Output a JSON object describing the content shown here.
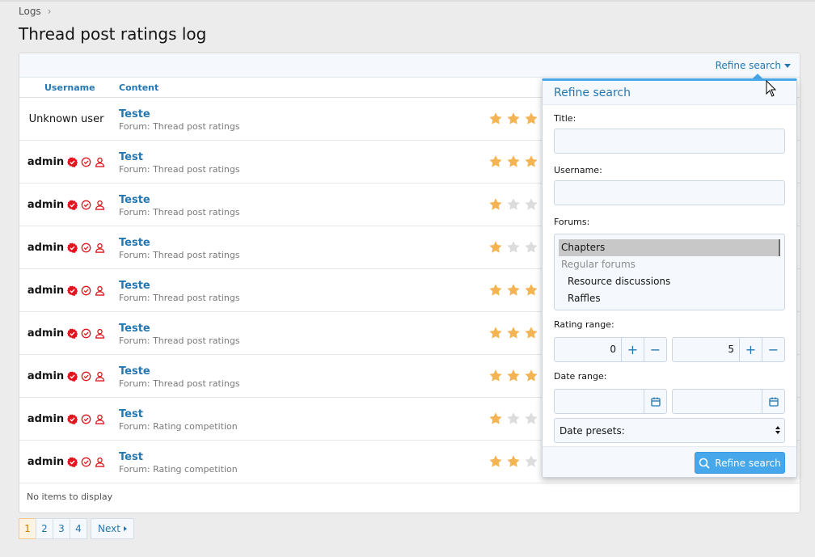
{
  "breadcrumb": {
    "item": "Logs"
  },
  "page_title": "Thread post ratings log",
  "filter_bar": {
    "refine_link": "Refine search"
  },
  "table": {
    "columns": [
      "Username",
      "Content"
    ],
    "rows": [
      {
        "user": "Unknown user",
        "unknown": true,
        "title": "Teste",
        "forum": "Forum: Thread post ratings",
        "rating": 3
      },
      {
        "user": "admin",
        "unknown": false,
        "title": "Test",
        "forum": "Forum: Thread post ratings",
        "rating": 3
      },
      {
        "user": "admin",
        "unknown": false,
        "title": "Teste",
        "forum": "Forum: Thread post ratings",
        "rating": 1
      },
      {
        "user": "admin",
        "unknown": false,
        "title": "Teste",
        "forum": "Forum: Thread post ratings",
        "rating": 1
      },
      {
        "user": "admin",
        "unknown": false,
        "title": "Teste",
        "forum": "Forum: Thread post ratings",
        "rating": 3
      },
      {
        "user": "admin",
        "unknown": false,
        "title": "Teste",
        "forum": "Forum: Thread post ratings",
        "rating": 3
      },
      {
        "user": "admin",
        "unknown": false,
        "title": "Teste",
        "forum": "Forum: Thread post ratings",
        "rating": 3
      },
      {
        "user": "admin",
        "unknown": false,
        "title": "Test",
        "forum": "Forum: Rating competition",
        "rating": 1
      },
      {
        "user": "admin",
        "unknown": false,
        "title": "Test",
        "forum": "Forum: Rating competition",
        "rating": 2
      }
    ],
    "footer_note": "No items to display"
  },
  "pagination": {
    "pages": [
      "1",
      "2",
      "3",
      "4"
    ],
    "current": "1",
    "next_label": "Next"
  },
  "refine_menu": {
    "title": "Refine search",
    "title_label": "Title:",
    "title_value": "",
    "username_label": "Username:",
    "username_value": "",
    "forums_label": "Forums:",
    "forums_options": [
      {
        "label": "Chapters",
        "type": "selected"
      },
      {
        "label": "Regular forums",
        "type": "group"
      },
      {
        "label": "Resource discussions",
        "type": "indented"
      },
      {
        "label": "Raffles",
        "type": "indented"
      }
    ],
    "rating_range_label": "Rating range:",
    "rating_min": "0",
    "rating_max": "5",
    "date_range_label": "Date range:",
    "date_from": "",
    "date_to": "",
    "date_presets": "Date presets:",
    "submit_label": "Refine search"
  },
  "colors": {
    "link": "#2577b1",
    "accent": "#47a7eb",
    "star_on": "#f4b453",
    "star_off": "#dcdcdc",
    "badge_red": "#e0161e"
  }
}
